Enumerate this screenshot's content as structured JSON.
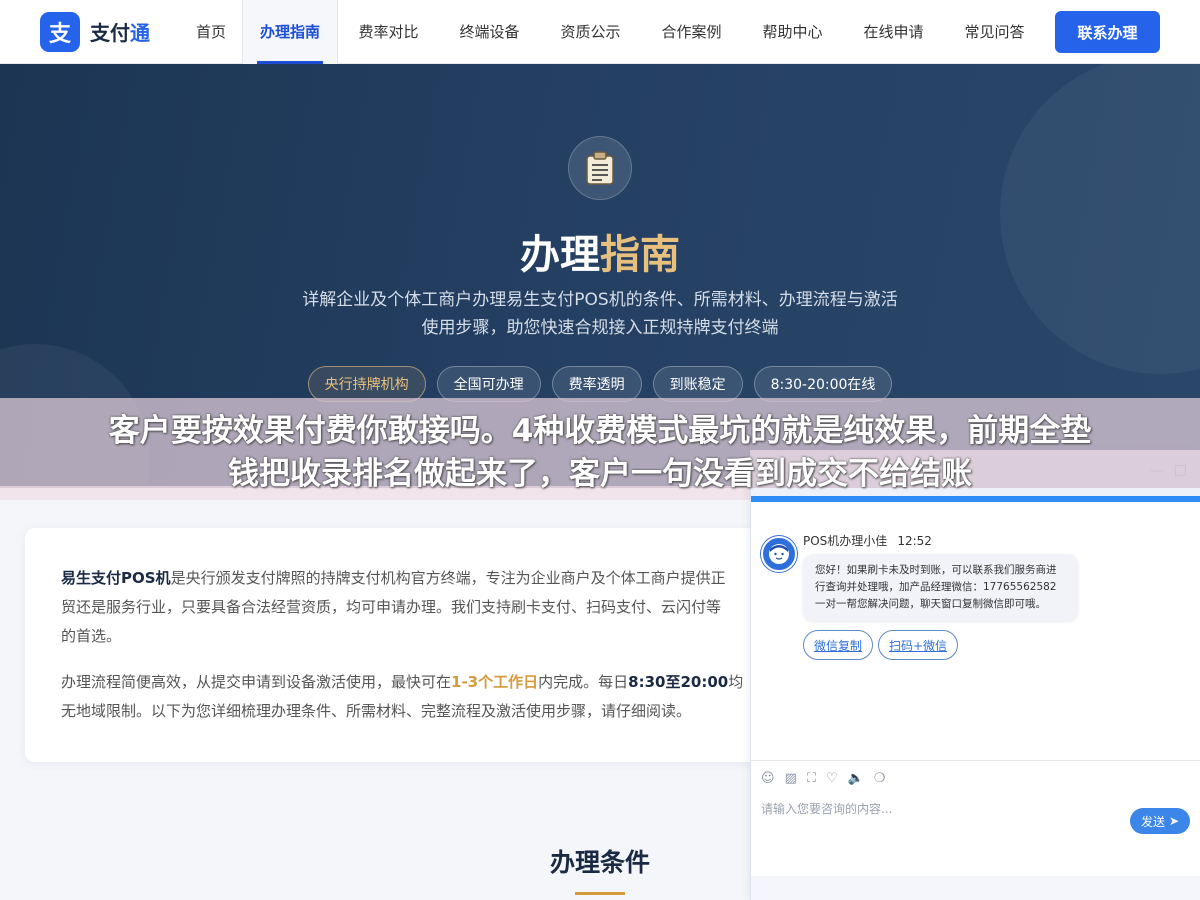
{
  "nav": {
    "logo_mark": "支",
    "logo_text": "支付",
    "logo_accent": "通",
    "items": [
      {
        "label": "首页"
      },
      {
        "label": "办理指南"
      },
      {
        "label": "费率对比"
      },
      {
        "label": "终端设备"
      },
      {
        "label": "资质公示"
      },
      {
        "label": "合作案例"
      },
      {
        "label": "帮助中心"
      },
      {
        "label": "在线申请"
      },
      {
        "label": "常见问答"
      }
    ],
    "active_index": 1,
    "contact_button": "联系办理"
  },
  "hero": {
    "icon": "clipboard-icon",
    "title_main": "办理",
    "title_accent": "指南",
    "subtitle_line1": "详解企业及个体工商户办理易生支付POS机的条件、所需材料、办理流程与激活",
    "subtitle_line2": "使用步骤，助您快速合规接入正规持牌支付终端",
    "tags": [
      "央行持牌机构",
      "全国可办理",
      "费率透明",
      "到账稳定",
      "8:30-20:00在线"
    ]
  },
  "overlay_caption": {
    "line1": "客户要按效果付费你敢接吗。4种收费模式最坑的就是纯效果，前期全垫",
    "line2": "钱把收录排名做起来了，客户一句没看到成交不给结账"
  },
  "intro": {
    "p1_strong": "易生支付POS机",
    "p1_line1": "是央行颁发支付牌照的持牌支付机构官方终端，专注为企业商户及个体工商户提供正",
    "p1_line2": "贸还是服务行业，只要具备合法经营资质，均可申请办理。我们支持刷卡支付、扫码支付、云闪付等",
    "p1_line3": "的首选。",
    "p2_a": "办理流程简便高效，从提交申请到设备激活使用，最快可在",
    "p2_hl": "1-3个工作日",
    "p2_b": "内完成。每日",
    "p2_strong": "8:30至20:00",
    "p2_c": "均",
    "p2_line2": "无地域限制。以下为您详细梳理办理条件、所需材料、完整流程及激活使用步骤，请仔细阅读。"
  },
  "section": {
    "title": "办理条件"
  },
  "chat": {
    "agent_name": "POS机办理小佳",
    "time": "12:52",
    "message": "您好！如果刷卡未及时到账，可以联系我们服务商进行查询并处理哦，加产品经理微信：17765562582 一对一帮您解决问题，聊天窗口复制微信即可哦。",
    "quick_replies": [
      "微信复制",
      "扫码+微信"
    ],
    "input_placeholder": "请输入您要咨询的内容...",
    "send_label": "发送",
    "tools": [
      "emoji-icon",
      "image-icon",
      "screenshot-icon",
      "rating-icon",
      "voice-icon",
      "chat-bubble-icon"
    ]
  },
  "colors": {
    "brand": "#2563eb",
    "gold": "#e8c07d",
    "hero_bg": "#243f62",
    "chat_accent": "#2e8df5"
  }
}
